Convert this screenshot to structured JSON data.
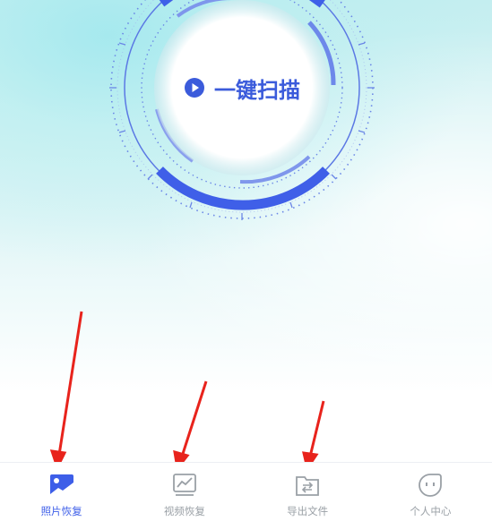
{
  "scan": {
    "label": "一键扫描",
    "accent": "#3b5bdb",
    "play_icon": "play-circle-icon"
  },
  "tabbar": {
    "active_color": "#3d5ee8",
    "inactive_color": "#9aa0a6",
    "items": [
      {
        "label": "照片恢复",
        "icon": "photo-icon",
        "active": true
      },
      {
        "label": "视频恢复",
        "icon": "video-chart-icon",
        "active": false
      },
      {
        "label": "导出文件",
        "icon": "export-folder-icon",
        "active": false
      },
      {
        "label": "个人中心",
        "icon": "profile-face-icon",
        "active": false
      }
    ]
  },
  "annotations": {
    "arrow_color": "#e8231c"
  }
}
